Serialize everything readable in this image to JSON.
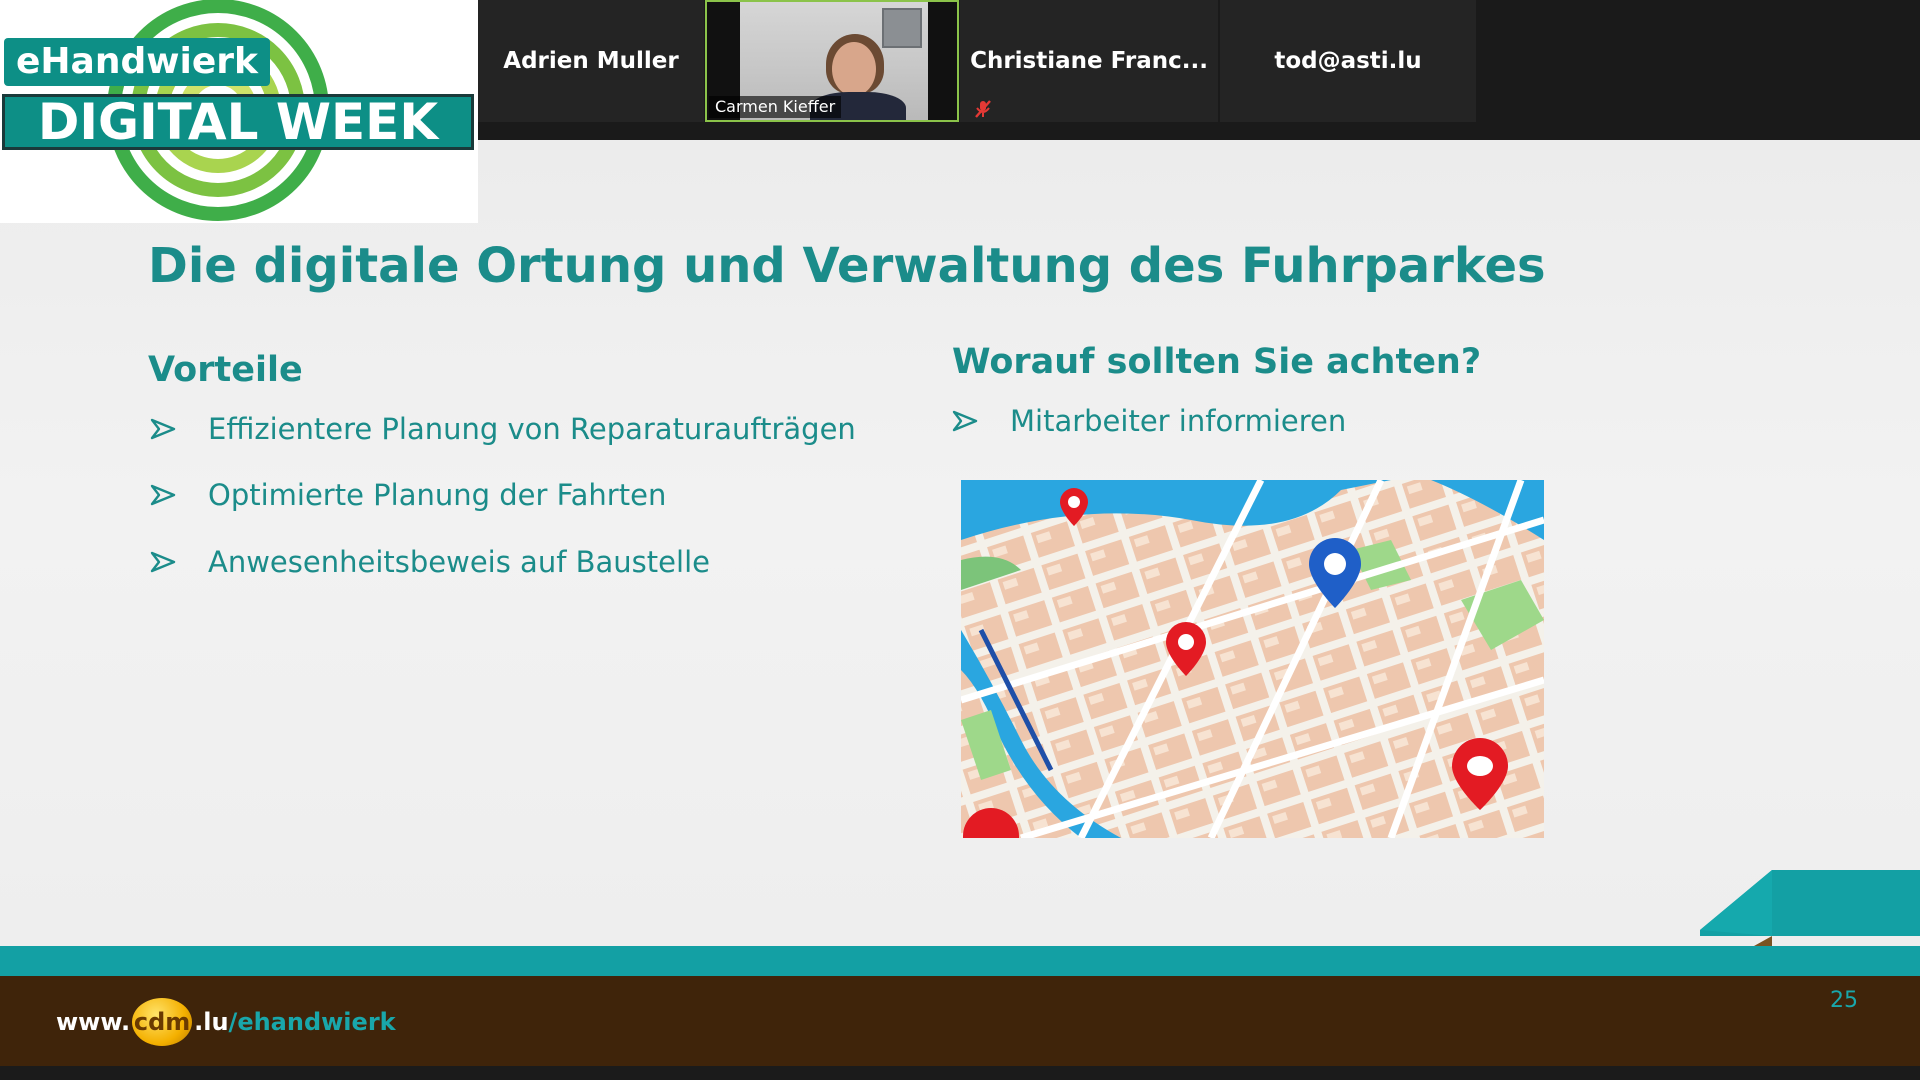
{
  "participants": {
    "tiles": [
      {
        "name": "Adrien Muller"
      },
      {
        "name": "Carmen Kieffer"
      },
      {
        "name": "Christiane  Franc..."
      },
      {
        "name": "tod@asti.lu"
      }
    ],
    "active_speaker_index": 1,
    "muted_icon": "muted-microphone-icon"
  },
  "logo": {
    "line1": "eHandwierk",
    "line2": "DIGITAL WEEK",
    "colors": {
      "teal": "#0d8f86",
      "green": "#8bc34a"
    }
  },
  "slide": {
    "title": "Die digitale Ortung und Verwaltung des Fuhrparkes",
    "left_column": {
      "heading": "Vorteile",
      "bullets": [
        "Effizientere Planung von Reparaturaufträgen",
        "Optimierte Planung der Fahrten",
        "Anwesenheitsbeweis auf Baustelle"
      ]
    },
    "right_column": {
      "heading": "Worauf sollten Sie achten?",
      "bullets": [
        "Mitarbeiter informieren"
      ]
    },
    "image": {
      "icon": "city-map-with-location-pins"
    },
    "footer": {
      "url_prefix": "www.",
      "url_brand": "cdm",
      "url_suffix": ".lu",
      "url_path": "/ehandwierk"
    },
    "page_number": "25",
    "colors": {
      "accent": "#1b8c8a",
      "footer_teal": "#13a0a4",
      "footer_brown": "#3f240a"
    }
  }
}
